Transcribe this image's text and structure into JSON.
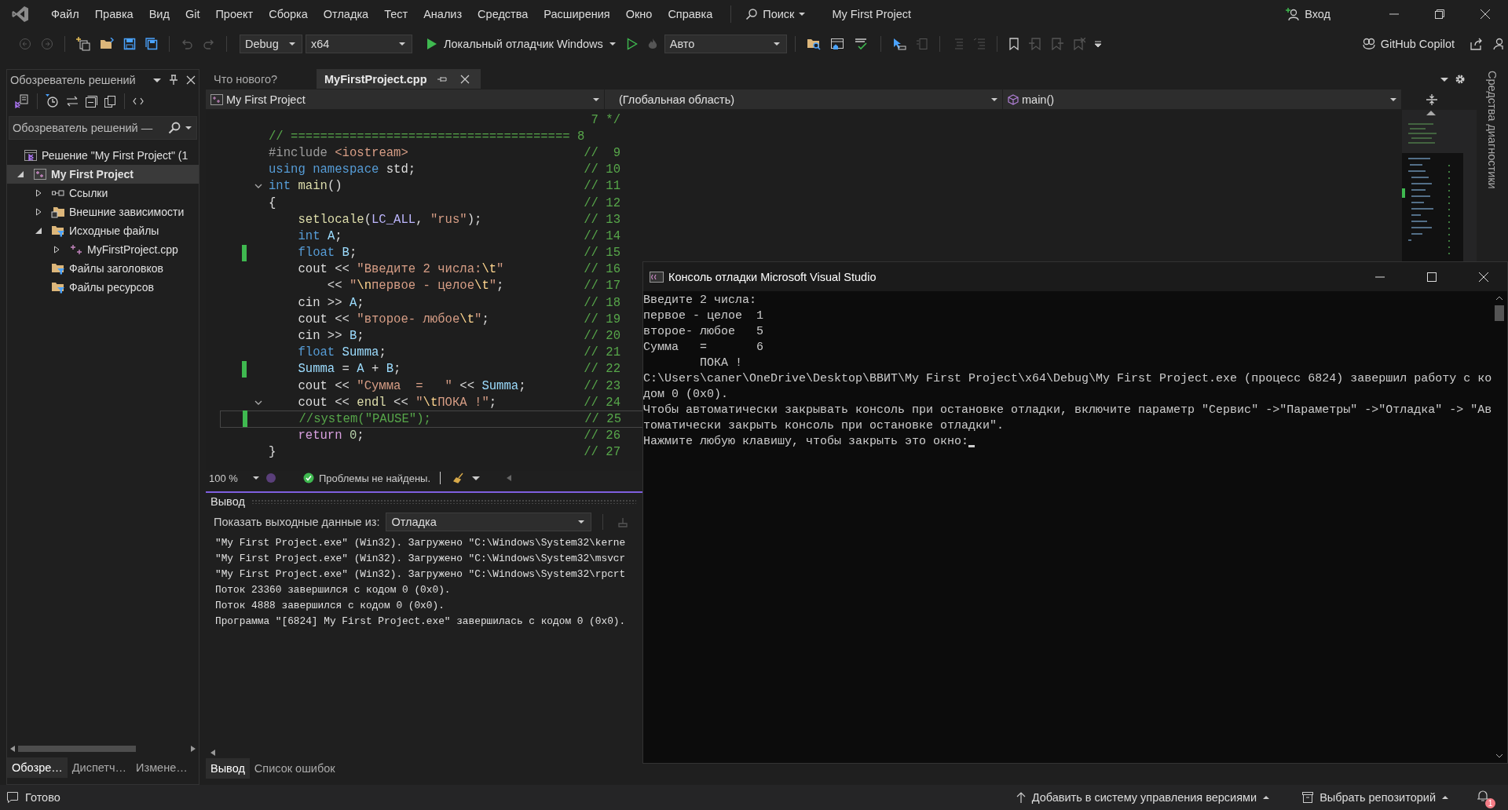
{
  "menu_bar": {
    "items": [
      "Файл",
      "Правка",
      "Вид",
      "Git",
      "Проект",
      "Сборка",
      "Отладка",
      "Тест",
      "Анализ",
      "Средства",
      "Расширения",
      "Окно",
      "Справка"
    ],
    "search": "Поиск",
    "title": "My First Project",
    "sign_in": "Вход"
  },
  "toolbar": {
    "configuration": "Debug",
    "platform": "x64",
    "run_target": "Локальный отладчик Windows",
    "mode": "Авто",
    "copilot": "GitHub Copilot"
  },
  "solution_explorer": {
    "title": "Обозреватель решений",
    "search_placeholder": "Обозреватель решений —",
    "tree": [
      {
        "label": "Решение \"My First Project\" (1",
        "kind": "solution",
        "selected": false,
        "startup": false,
        "children": [
          {
            "label": "My First Project",
            "kind": "project",
            "expanded": true,
            "selected": true,
            "startup": true,
            "children": [
              {
                "label": "Ссылки",
                "kind": "references",
                "expanded": false,
                "selected": false,
                "startup": false
              },
              {
                "label": "Внешние зависимости",
                "kind": "external",
                "expanded": false,
                "selected": false,
                "startup": false
              },
              {
                "label": "Исходные файлы",
                "kind": "filter",
                "expanded": true,
                "selected": false,
                "startup": false,
                "children": [
                  {
                    "label": "MyFirstProject.cpp",
                    "kind": "cpp",
                    "expanded": false,
                    "selected": false,
                    "startup": false
                  }
                ]
              },
              {
                "label": "Файлы заголовков",
                "kind": "filter",
                "selected": false,
                "startup": false
              },
              {
                "label": "Файлы ресурсов",
                "kind": "filter",
                "selected": false,
                "startup": false
              }
            ]
          }
        ]
      }
    ],
    "bottom_tabs": [
      {
        "label": "Обозре…",
        "selected": true
      },
      {
        "label": "Диспетч…",
        "selected": false
      },
      {
        "label": "Измене…",
        "selected": false
      }
    ]
  },
  "editor": {
    "tabs": [
      {
        "label": "Что нового?",
        "selected": false
      },
      {
        "label": "MyFirstProject.cpp",
        "selected": true
      }
    ],
    "project": "My First Project",
    "scope": "(Глобальная область)",
    "member": "main()",
    "lines": [
      {
        "comment": "7 */",
        "changed": false,
        "fold": false,
        "current": false
      },
      {
        "segments": [
          {
            "kind": "comment",
            "text": "// ====================================== 8"
          }
        ],
        "changed": false,
        "fold": false,
        "current": false
      },
      {
        "segments": [
          {
            "kind": "preproc",
            "text": "#include "
          },
          {
            "kind": "string",
            "text": "<iostream>"
          }
        ],
        "comment": "//  9",
        "changed": false,
        "fold": false,
        "current": false
      },
      {
        "segments": [
          {
            "kind": "keyword",
            "text": "using namespace"
          },
          {
            "kind": "plain",
            "text": " std;"
          }
        ],
        "comment": "// 10",
        "changed": false,
        "fold": false,
        "current": false
      },
      {
        "segments": [
          {
            "kind": "keyword",
            "text": "int "
          },
          {
            "kind": "func",
            "text": "main"
          },
          {
            "kind": "plain",
            "text": "()"
          }
        ],
        "comment": "// 11",
        "changed": false,
        "fold": true,
        "current": false
      },
      {
        "segments": [
          {
            "kind": "plain",
            "text": "{"
          }
        ],
        "comment": "// 12",
        "changed": false,
        "fold": false,
        "current": false
      },
      {
        "segments": [
          {
            "kind": "func",
            "text": "    setlocale"
          },
          {
            "kind": "plain",
            "text": "("
          },
          {
            "kind": "macro",
            "text": "LC_ALL"
          },
          {
            "kind": "plain",
            "text": ", "
          },
          {
            "kind": "string",
            "text": "\"rus\""
          },
          {
            "kind": "plain",
            "text": ");"
          }
        ],
        "comment": "// 13",
        "changed": false,
        "fold": false,
        "current": false
      },
      {
        "segments": [
          {
            "kind": "keyword",
            "text": "    int "
          },
          {
            "kind": "ident",
            "text": "A"
          },
          {
            "kind": "plain",
            "text": ";"
          }
        ],
        "comment": "// 14",
        "changed": false,
        "fold": false,
        "current": false
      },
      {
        "segments": [
          {
            "kind": "keyword",
            "text": "    float "
          },
          {
            "kind": "ident",
            "text": "B"
          },
          {
            "kind": "plain",
            "text": ";"
          }
        ],
        "comment": "// 15",
        "changed": true,
        "fold": false,
        "current": false
      },
      {
        "segments": [
          {
            "kind": "plain",
            "text": "    cout << "
          },
          {
            "kind": "string",
            "text": "\"Введите 2 числа:"
          },
          {
            "kind": "escape",
            "text": "\\t"
          },
          {
            "kind": "string",
            "text": "\""
          }
        ],
        "comment": "// 16",
        "changed": false,
        "fold": false,
        "current": false
      },
      {
        "segments": [
          {
            "kind": "plain",
            "text": "        << "
          },
          {
            "kind": "string",
            "text": "\""
          },
          {
            "kind": "escape",
            "text": "\\n"
          },
          {
            "kind": "string",
            "text": "первое - целое"
          },
          {
            "kind": "escape",
            "text": "\\t"
          },
          {
            "kind": "string",
            "text": "\""
          },
          {
            "kind": "plain",
            "text": ";"
          }
        ],
        "comment": "// 17",
        "changed": false,
        "fold": false,
        "current": false
      },
      {
        "segments": [
          {
            "kind": "plain",
            "text": "    cin >> "
          },
          {
            "kind": "ident",
            "text": "A"
          },
          {
            "kind": "plain",
            "text": ";"
          }
        ],
        "comment": "// 18",
        "changed": false,
        "fold": false,
        "current": false
      },
      {
        "segments": [
          {
            "kind": "plain",
            "text": "    cout << "
          },
          {
            "kind": "string",
            "text": "\"второе- любое"
          },
          {
            "kind": "escape",
            "text": "\\t"
          },
          {
            "kind": "string",
            "text": "\""
          },
          {
            "kind": "plain",
            "text": ";"
          }
        ],
        "comment": "// 19",
        "changed": false,
        "fold": false,
        "current": false
      },
      {
        "segments": [
          {
            "kind": "plain",
            "text": "    cin >> "
          },
          {
            "kind": "ident",
            "text": "B"
          },
          {
            "kind": "plain",
            "text": ";"
          }
        ],
        "comment": "// 20",
        "changed": false,
        "fold": false,
        "current": false
      },
      {
        "segments": [
          {
            "kind": "keyword",
            "text": "    float "
          },
          {
            "kind": "ident",
            "text": "Summa"
          },
          {
            "kind": "plain",
            "text": ";"
          }
        ],
        "comment": "// 21",
        "changed": false,
        "fold": false,
        "current": false
      },
      {
        "segments": [
          {
            "kind": "ident",
            "text": "    Summa"
          },
          {
            "kind": "plain",
            "text": " = "
          },
          {
            "kind": "ident",
            "text": "A"
          },
          {
            "kind": "plain",
            "text": " + "
          },
          {
            "kind": "ident",
            "text": "B"
          },
          {
            "kind": "plain",
            "text": ";"
          }
        ],
        "comment": "// 22",
        "changed": true,
        "fold": false,
        "current": false
      },
      {
        "segments": [
          {
            "kind": "plain",
            "text": "    cout << "
          },
          {
            "kind": "string",
            "text": "\"Сумма  =   \""
          },
          {
            "kind": "plain",
            "text": " << "
          },
          {
            "kind": "ident",
            "text": "Summa"
          },
          {
            "kind": "plain",
            "text": ";"
          }
        ],
        "comment": "// 23",
        "changed": false,
        "fold": false,
        "current": false
      },
      {
        "segments": [
          {
            "kind": "plain",
            "text": "    cout << "
          },
          {
            "kind": "func",
            "text": "endl"
          },
          {
            "kind": "plain",
            "text": " << "
          },
          {
            "kind": "string",
            "text": "\""
          },
          {
            "kind": "escape",
            "text": "\\t"
          },
          {
            "kind": "string",
            "text": "ПОКА !\""
          },
          {
            "kind": "plain",
            "text": ";"
          }
        ],
        "comment": "// 24",
        "changed": false,
        "fold": true,
        "current": false
      },
      {
        "segments": [
          {
            "kind": "comment",
            "text": "    //system(\"PAUSE\");"
          }
        ],
        "comment": "// 25",
        "changed": true,
        "fold": false,
        "current": true
      },
      {
        "segments": [
          {
            "kind": "control",
            "text": "    return "
          },
          {
            "kind": "number",
            "text": "0"
          },
          {
            "kind": "plain",
            "text": ";"
          }
        ],
        "comment": "// 26",
        "changed": false,
        "fold": false,
        "current": false
      },
      {
        "segments": [
          {
            "kind": "plain",
            "text": "}"
          }
        ],
        "comment": "// 27",
        "changed": false,
        "fold": false,
        "current": false
      }
    ],
    "zoom": "100 %",
    "issues": "Проблемы не найдены."
  },
  "output": {
    "title": "Вывод",
    "source_label": "Показать выходные данные из:",
    "source": "Отладка",
    "lines": [
      "\"My First Project.exe\" (Win32). Загружено \"C:\\Windows\\System32\\kerne",
      "\"My First Project.exe\" (Win32). Загружено \"C:\\Windows\\System32\\msvcr",
      "\"My First Project.exe\" (Win32). Загружено \"C:\\Windows\\System32\\rpcrt",
      "Поток 23360 завершился с кодом 0 (0x0).",
      "Поток 4888 завершился с кодом 0 (0x0).",
      "Программа \"[6824] My First Project.exe\" завершилась с кодом 0 (0x0)."
    ]
  },
  "bottom_tabs": [
    {
      "label": "Вывод",
      "selected": true
    },
    {
      "label": "Список ошибок",
      "selected": false
    }
  ],
  "side_tab": "Средства диагностики",
  "console": {
    "title": "Консоль отладки Microsoft Visual Studio",
    "lines": [
      "Введите 2 числа:",
      "первое - целое  1",
      "второе- любое   5",
      "Сумма   =       6",
      "        ПОКА !",
      "C:\\Users\\caner\\OneDrive\\Desktop\\ВВИТ\\My First Project\\x64\\Debug\\My First Project.exe (процесс 6824) завершил работу с ко",
      "дом 0 (0x0).",
      "Чтобы автоматически закрывать консоль при остановке отладки, включите параметр \"Сервис\" ->\"Параметры\" ->\"Отладка\" -> \"Ав",
      "томатически закрыть консоль при остановке отладки\".",
      "Нажмите любую клавишу, чтобы закрыть это окно:"
    ]
  },
  "status_bar": {
    "text": "Готово",
    "source_control": "Добавить в систему управления версиями",
    "repository": "Выбрать репозиторий",
    "notifications": "1"
  }
}
